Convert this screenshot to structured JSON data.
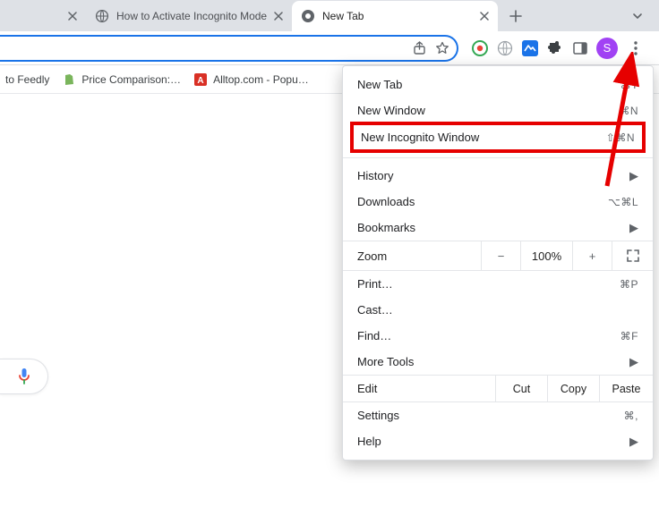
{
  "tabs": {
    "inactive": "How to Activate Incognito Mode",
    "active": "New Tab"
  },
  "bookmarks": [
    "to Feedly",
    "Price Comparison:…",
    "Alltop.com - Popu…"
  ],
  "avatar_letter": "S",
  "menu": {
    "new_tab": {
      "label": "New Tab",
      "shortcut": "⌘T"
    },
    "new_window": {
      "label": "New Window",
      "shortcut": "⌘N"
    },
    "new_incognito": {
      "label": "New Incognito Window",
      "shortcut": "⇧⌘N"
    },
    "history": {
      "label": "History"
    },
    "downloads": {
      "label": "Downloads",
      "shortcut": "⌥⌘L"
    },
    "bookmarks": {
      "label": "Bookmarks"
    },
    "zoom": {
      "label": "Zoom",
      "value": "100%"
    },
    "print": {
      "label": "Print…",
      "shortcut": "⌘P"
    },
    "cast": {
      "label": "Cast…"
    },
    "find": {
      "label": "Find…",
      "shortcut": "⌘F"
    },
    "more_tools": {
      "label": "More Tools"
    },
    "edit": {
      "label": "Edit",
      "cut": "Cut",
      "copy": "Copy",
      "paste": "Paste"
    },
    "settings": {
      "label": "Settings",
      "shortcut": "⌘,"
    },
    "help": {
      "label": "Help"
    }
  }
}
